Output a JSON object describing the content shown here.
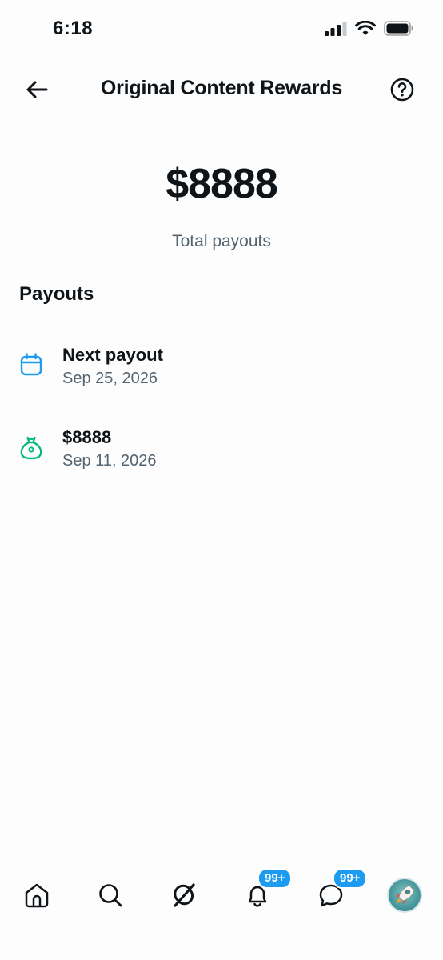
{
  "status_bar": {
    "time": "6:18"
  },
  "header": {
    "title": "Original Content Rewards",
    "back_icon": "arrow-left-icon",
    "help_icon": "question-circle-icon"
  },
  "summary": {
    "amount": "$8888",
    "label": "Total payouts"
  },
  "payouts": {
    "section_title": "Payouts",
    "items": [
      {
        "icon": "calendar-icon",
        "title": "Next payout",
        "date": "Sep 25, 2026",
        "icon_color": "#1d9bf0"
      },
      {
        "icon": "money-bag-icon",
        "title": "$8888",
        "date": "Sep 11, 2026",
        "icon_color": "#00ba7c"
      }
    ]
  },
  "bottom_nav": {
    "items": [
      {
        "name": "home",
        "icon": "home-icon"
      },
      {
        "name": "search",
        "icon": "search-icon"
      },
      {
        "name": "grok",
        "icon": "grok-icon"
      },
      {
        "name": "notifications",
        "icon": "bell-icon",
        "badge": "99+"
      },
      {
        "name": "messages",
        "icon": "message-icon",
        "badge": "99+"
      },
      {
        "name": "profile",
        "icon": "avatar"
      }
    ]
  },
  "colors": {
    "accent": "#1d9bf0",
    "success": "#00ba7c",
    "secondary_text": "#536471"
  }
}
